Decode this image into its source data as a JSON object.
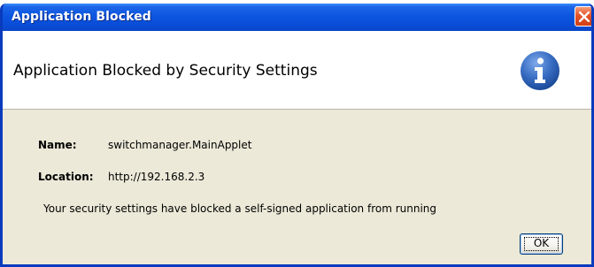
{
  "window": {
    "title": "Application Blocked"
  },
  "header": {
    "title": "Application Blocked by Security Settings",
    "icon": "info-icon"
  },
  "details": {
    "name_label": "Name:",
    "name_value": "switchmanager.MainApplet",
    "location_label": "Location:",
    "location_value": "http://192.168.2.3",
    "message": "Your security settings have blocked a self-signed application from running"
  },
  "buttons": {
    "ok_label": "OK"
  },
  "colors": {
    "titlebar_blue": "#0a4fd6",
    "dialog_face": "#ece9d8",
    "close_red": "#e4542a",
    "info_blue": "#3a6fc4"
  }
}
